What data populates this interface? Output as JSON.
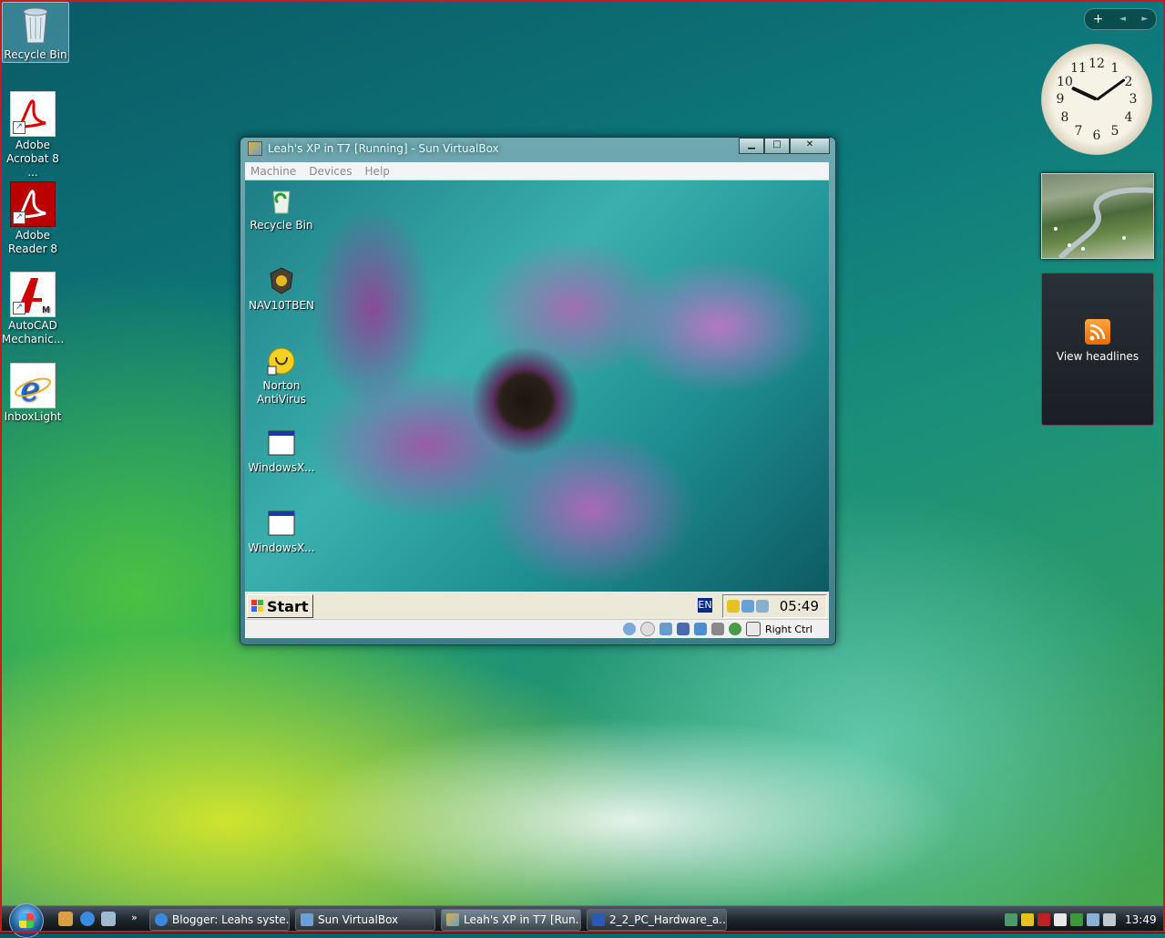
{
  "desktop": {
    "icons": [
      {
        "label": "Recycle Bin"
      },
      {
        "label": "Adobe Acrobat 8 ..."
      },
      {
        "label": "Adobe Reader 8"
      },
      {
        "label": "AutoCAD Mechanic..."
      },
      {
        "label": "InboxLight"
      }
    ]
  },
  "gadgets": {
    "controls": {
      "add": "+",
      "prev": "◄",
      "next": "►"
    },
    "clock_numbers": [
      "12",
      "1",
      "2",
      "3",
      "4",
      "5",
      "6",
      "7",
      "8",
      "9",
      "10",
      "11"
    ],
    "feed_label": "View headlines"
  },
  "vbox": {
    "title": "Leah's XP in T7 [Running] - Sun VirtualBox",
    "window_buttons": {
      "minimize": "▁",
      "maximize": "□",
      "close": "✕"
    },
    "menu": [
      "Machine",
      "Devices",
      "Help"
    ],
    "guest_icons": [
      {
        "label": "Recycle Bin"
      },
      {
        "label": "NAV10TBEN"
      },
      {
        "label": "Norton AntiVirus"
      },
      {
        "label": "WindowsX..."
      },
      {
        "label": "WindowsX..."
      }
    ],
    "start_label": "Start",
    "lang": "EN",
    "guest_time": "05:49",
    "host_key": "Right Ctrl"
  },
  "taskbar": {
    "buttons": [
      {
        "label": "Blogger: Leahs syste..."
      },
      {
        "label": "Sun VirtualBox"
      },
      {
        "label": "Leah's XP in T7 [Run..."
      },
      {
        "label": "2_2_PC_Hardware_a..."
      }
    ],
    "overflow": "»",
    "time": "13:49"
  },
  "colors": {
    "accent": "#1a5a9a",
    "frame": "#d01818",
    "rss": "#e86a00"
  }
}
